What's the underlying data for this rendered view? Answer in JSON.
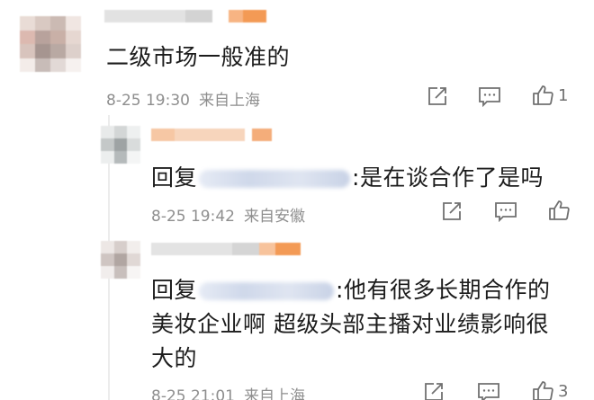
{
  "colors": {
    "text": "#1c1c1c",
    "meta": "#8e8e8e",
    "icon": "#707070",
    "name_blur_orange": "#f5a76b",
    "name_blur_gray": "#d8d8d8",
    "mask_blue": "#cdd6e8"
  },
  "comments": [
    {
      "text": "二级市场一般准的",
      "time": "8-25 19:30",
      "location": "来自上海",
      "like_count": "1",
      "icons": [
        "share-icon",
        "comment-icon",
        "like-icon"
      ]
    },
    {
      "reply_prefix": "回复",
      "text": ":是在谈合作了是吗",
      "time": "8-25 19:42",
      "location": "来自安徽",
      "like_count": "",
      "icons": [
        "share-icon",
        "comment-icon",
        "like-icon"
      ]
    },
    {
      "reply_prefix": "回复",
      "text_line1": ":他有很多长期合作的",
      "text_line2": "美妆企业啊 超级头部主播对业绩影响很",
      "text_line3": "大的",
      "time": "8-25 21:01",
      "location": "来自上海",
      "like_count": "3",
      "icons": [
        "share-icon",
        "comment-icon",
        "like-icon"
      ]
    }
  ]
}
